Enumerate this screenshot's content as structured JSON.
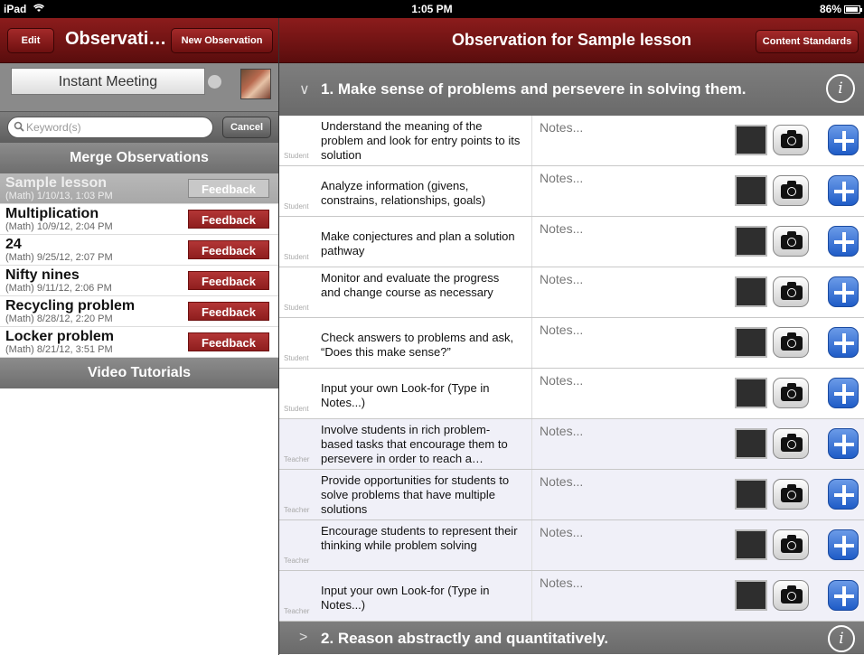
{
  "status": {
    "carrier": "iPad",
    "time": "1:05 PM",
    "battery": "86%"
  },
  "left": {
    "edit_label": "Edit",
    "title": "Observati…",
    "new_label": "New Observation",
    "instant_meeting": "Instant Meeting",
    "search_placeholder": "Keyword(s)",
    "cancel_label": "Cancel",
    "merge_label": "Merge Observations",
    "observations": [
      {
        "title": "Sample lesson",
        "sub": "(Math) 1/10/13, 1:03 PM",
        "feedback": "Feedback",
        "selected": true
      },
      {
        "title": "Multiplication",
        "sub": "(Math) 10/9/12, 2:04 PM",
        "feedback": "Feedback",
        "selected": false
      },
      {
        "title": "24",
        "sub": "(Math) 9/25/12, 2:07 PM",
        "feedback": "Feedback",
        "selected": false
      },
      {
        "title": "Nifty nines",
        "sub": "(Math) 9/11/12, 2:06 PM",
        "feedback": "Feedback",
        "selected": false
      },
      {
        "title": "Recycling problem",
        "sub": "(Math) 8/28/12, 2:20 PM",
        "feedback": "Feedback",
        "selected": false
      },
      {
        "title": "Locker problem",
        "sub": "(Math) 8/21/12, 3:51 PM",
        "feedback": "Feedback",
        "selected": false
      }
    ],
    "video_label": "Video Tutorials"
  },
  "right": {
    "title": "Observation for Sample lesson",
    "content_standards_label": "Content Standards",
    "standard1": {
      "chevron": "∨",
      "title": "1. Make sense of problems and persevere in solving them.",
      "info": "i"
    },
    "rows": [
      {
        "role": "Student",
        "text": "Understand the meaning of the problem and look for entry points to its solution",
        "notes": "Notes..."
      },
      {
        "role": "Student",
        "text": "Analyze information (givens, constrains, relationships, goals)",
        "notes": "Notes..."
      },
      {
        "role": "Student",
        "text": "Make conjectures and plan a solution pathway",
        "notes": "Notes..."
      },
      {
        "role": "Student",
        "text": "Monitor and evaluate the progress and change course as necessary",
        "notes": "Notes..."
      },
      {
        "role": "Student",
        "text": "Check answers to problems and ask, “Does this make sense?”",
        "notes": "Notes..."
      },
      {
        "role": "Student",
        "text": "Input your own Look-for (Type in Notes...)",
        "notes": "Notes..."
      },
      {
        "role": "Teacher",
        "text": "Involve students in rich problem-based tasks that encourage them to persevere in order to reach a…",
        "notes": "Notes..."
      },
      {
        "role": "Teacher",
        "text": "Provide opportunities for students to solve problems that have multiple solutions",
        "notes": "Notes..."
      },
      {
        "role": "Teacher",
        "text": "Encourage students to represent their thinking while problem solving",
        "notes": "Notes..."
      },
      {
        "role": "Teacher",
        "text": "Input your own Look-for (Type in Notes...)",
        "notes": "Notes..."
      }
    ],
    "standard2": {
      "chevron": ">",
      "title": "2. Reason abstractly and quantitatively.",
      "info": "i"
    }
  }
}
